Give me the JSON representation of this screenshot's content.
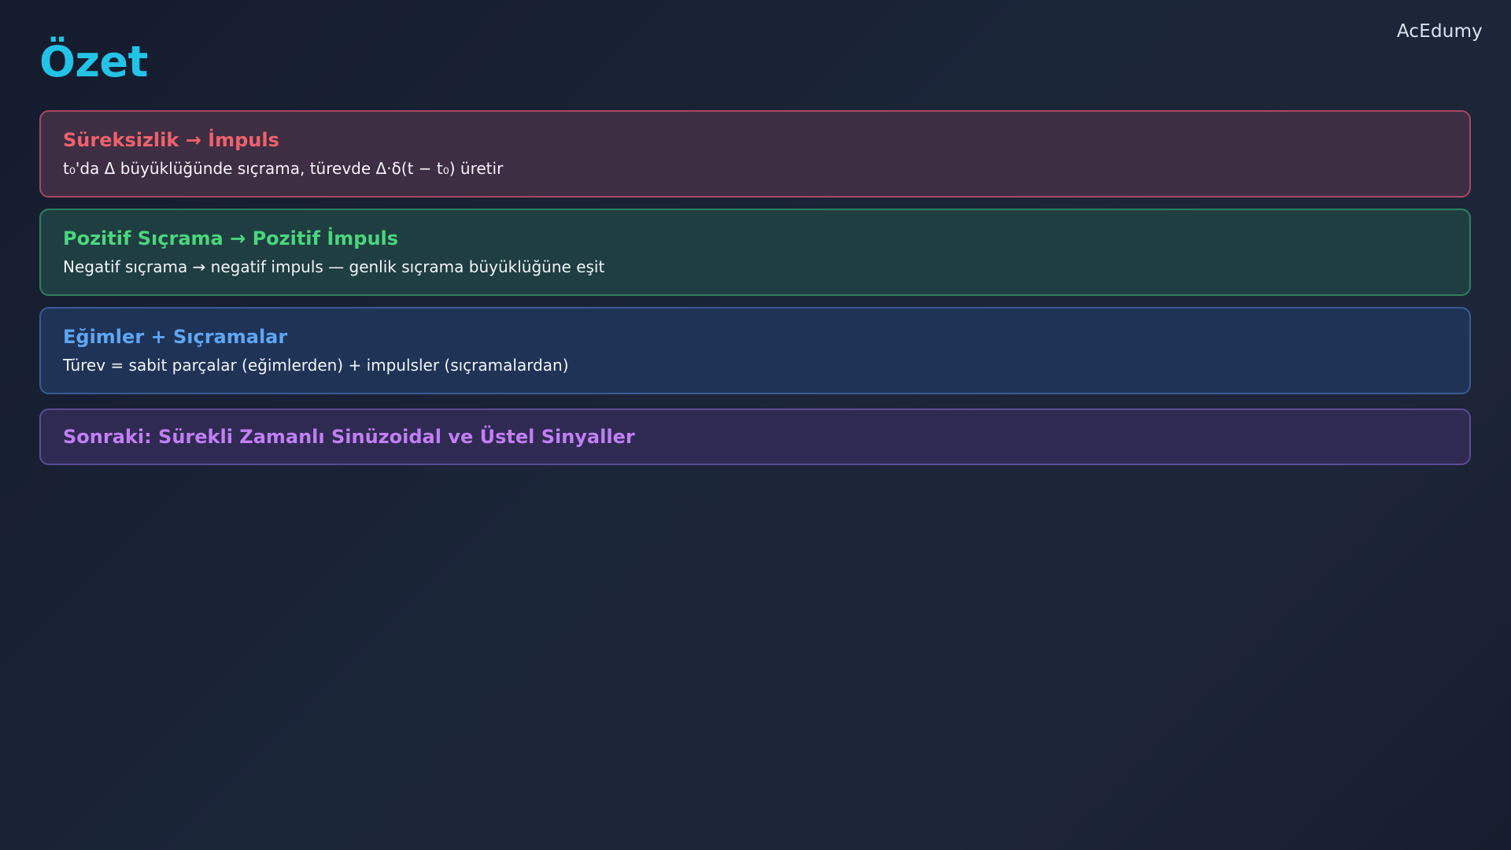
{
  "brand": "AcEdumy",
  "title": "Özet",
  "cards": [
    {
      "title": "Süreksizlik → İmpuls",
      "description": "t₀'da Δ büyüklüğünde sıçrama, türevde Δ·δ(t − t₀) üretir",
      "accent": "#f0616c"
    },
    {
      "title": "Pozitif Sıçrama → Pozitif İmpuls",
      "description": "Negatif sıçrama → negatif impuls — genlik sıçrama büyüklüğüne eşit",
      "accent": "#4ad67c"
    },
    {
      "title": "Eğimler + Sıçramalar",
      "description": "Türev = sabit parçalar (eğimlerden) + impulsler (sıçramalardan)",
      "accent": "#5ea6f5"
    },
    {
      "title": "Sonraki: Sürekli Zamanlı Sinüzoidal ve Üstel Sinyaller",
      "accent": "#c27ef5"
    }
  ]
}
